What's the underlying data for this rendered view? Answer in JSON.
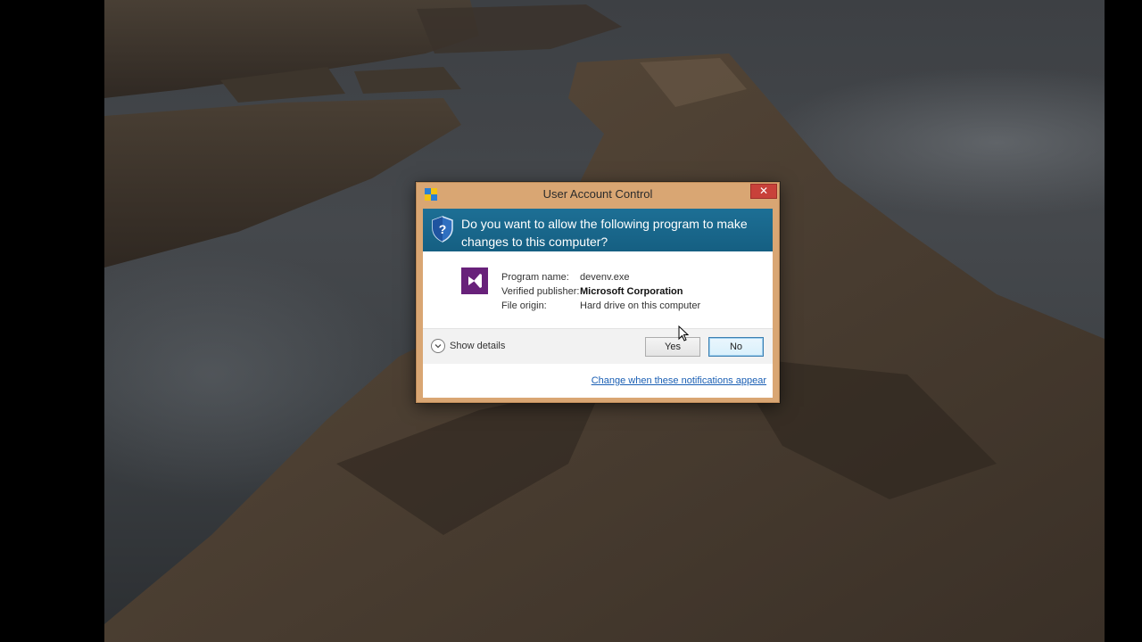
{
  "window": {
    "title": "User Account Control",
    "close_label": "✕"
  },
  "prompt": {
    "question": "Do you want to allow the following program to make changes to this computer?"
  },
  "program": {
    "name_label": "Program name:",
    "name_value": "devenv.exe",
    "publisher_label": "Verified publisher:",
    "publisher_value": "Microsoft Corporation",
    "origin_label": "File origin:",
    "origin_value": "Hard drive on this computer"
  },
  "actions": {
    "show_details": "Show details",
    "yes_label": "Yes",
    "no_label": "No"
  },
  "footer": {
    "link_text": "Change when these notifications appear"
  },
  "colors": {
    "title_bar": "#d9a673",
    "question_band": "#1d6f95",
    "close_button": "#c8413a",
    "vs_icon": "#68217a",
    "link": "#1a5fb4"
  },
  "icons": {
    "title": "uac-shield-icon",
    "question": "shield-question-icon",
    "program": "visual-studio-icon",
    "expand": "chevron-down-icon"
  }
}
